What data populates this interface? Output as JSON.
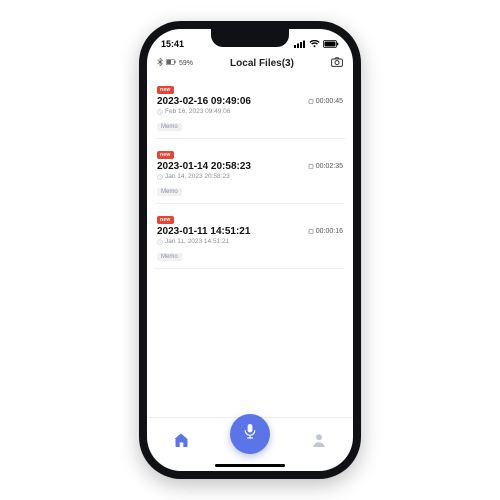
{
  "status": {
    "time": "15:41",
    "battery_pct": "59%"
  },
  "header": {
    "title": "Local Files(3)"
  },
  "files": [
    {
      "badge": "new",
      "name": "2023-02-16 09:49:06",
      "subtitle": "Feb 16, 2023 09:49:06",
      "duration": "00:00:45",
      "tag": "Memo"
    },
    {
      "badge": "new",
      "name": "2023-01-14 20:58:23",
      "subtitle": "Jan 14, 2023 20:58:23",
      "duration": "00:02:35",
      "tag": "Memo"
    },
    {
      "badge": "new",
      "name": "2023-01-11 14:51:21",
      "subtitle": "Jan 11, 2023 14:51:21",
      "duration": "00:00:16",
      "tag": "Memo"
    }
  ],
  "colors": {
    "accent": "#5b74e8",
    "badge": "#e64533"
  }
}
